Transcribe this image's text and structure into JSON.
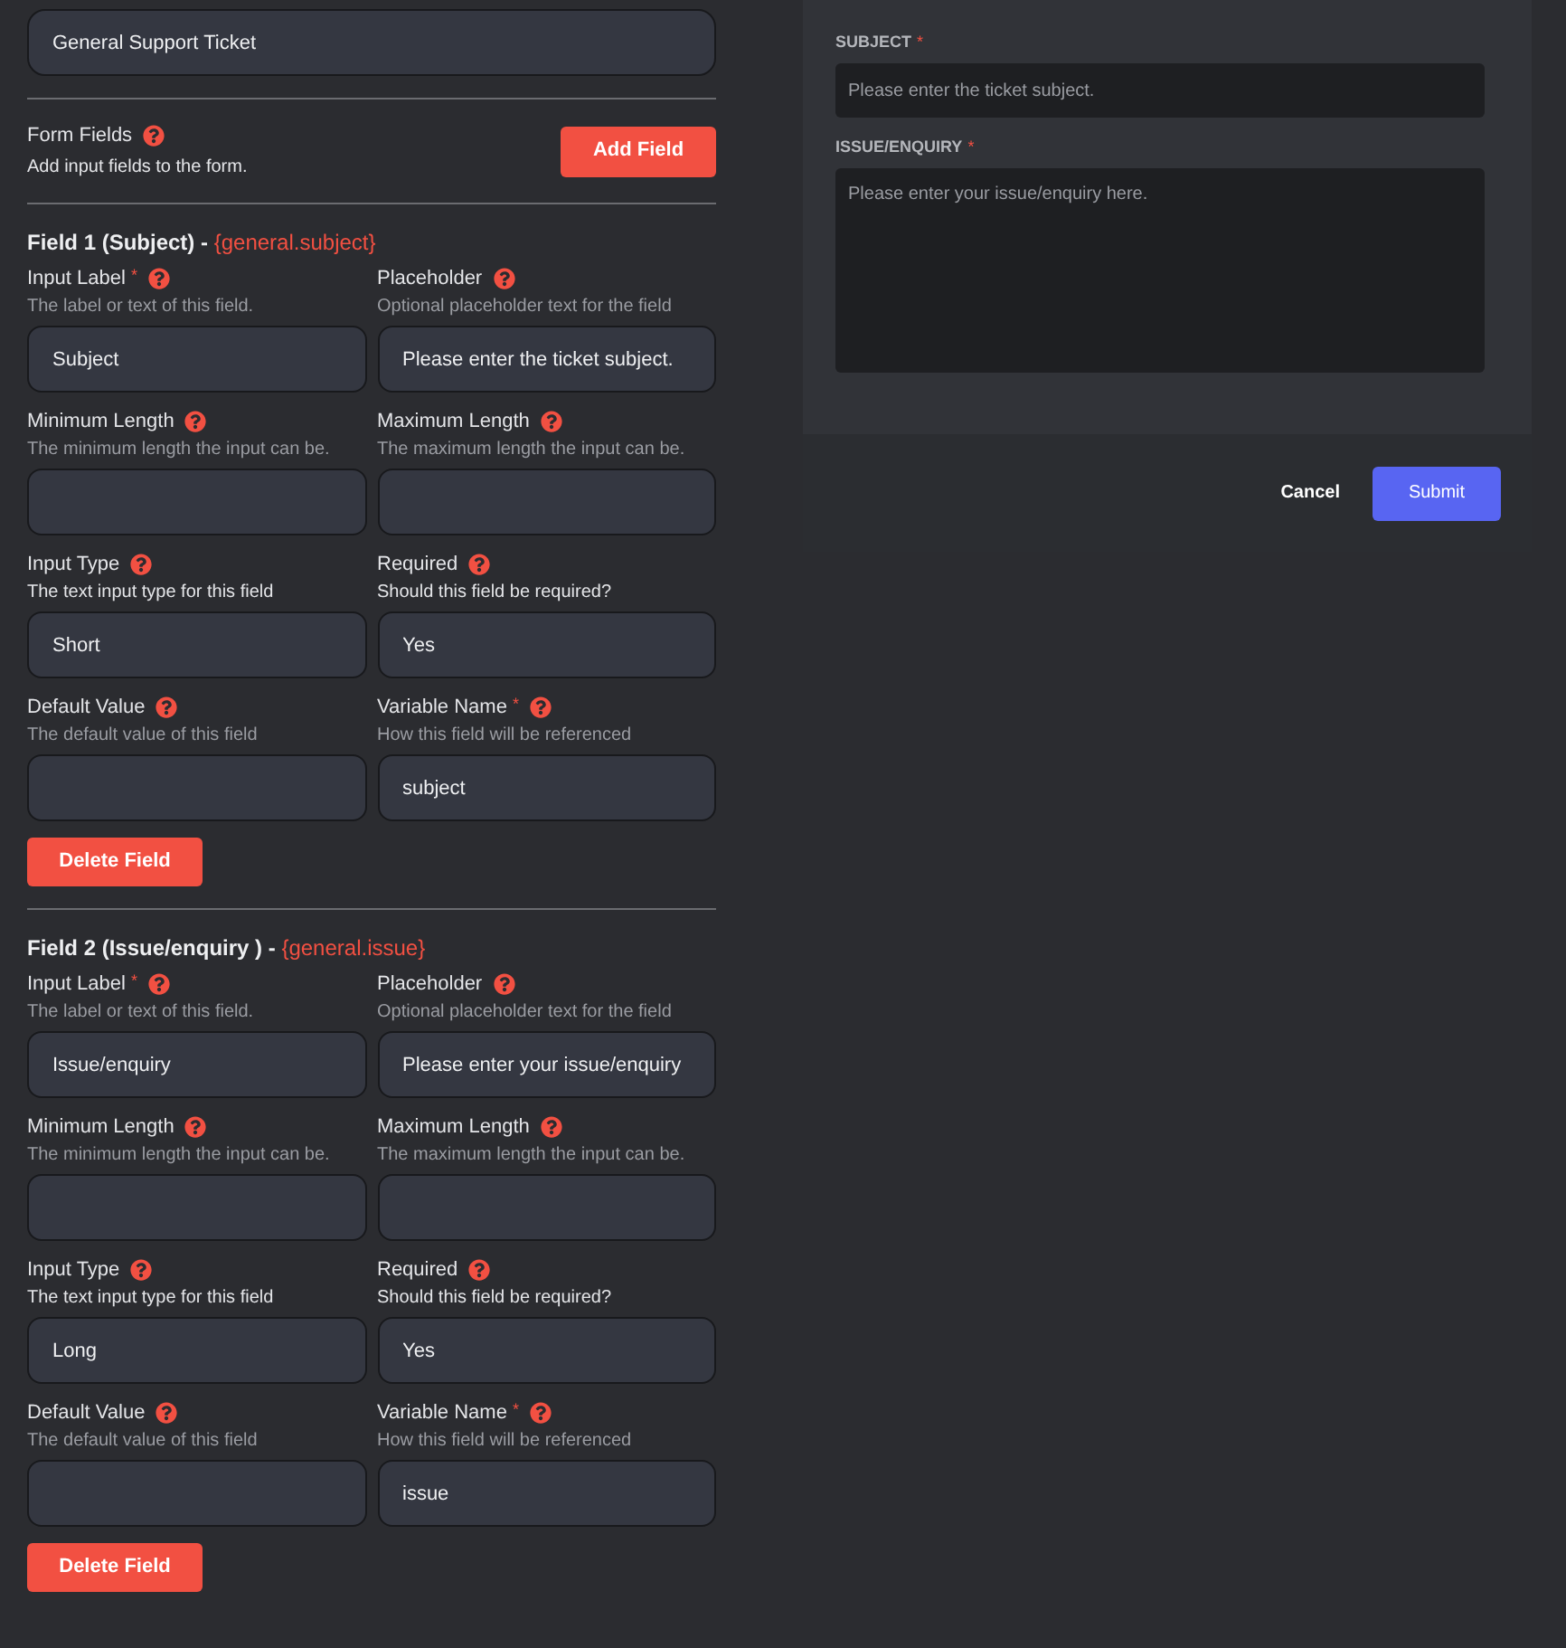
{
  "form_name": {
    "value": "General Support Ticket"
  },
  "form_fields": {
    "title": "Form Fields",
    "description": "Add input fields to the form.",
    "add_button": "Add Field"
  },
  "fields": [
    {
      "title": "Field 1 (Subject) - ",
      "variable_ref": "{general.subject}",
      "delete_button": "Delete Field",
      "settings": [
        {
          "label": "Input Label",
          "required_mark": "*",
          "description": "The label or text of this field.",
          "emphasis": false,
          "value": "Subject"
        },
        {
          "label": "Placeholder",
          "description": "Optional placeholder text for the field",
          "emphasis": false,
          "value": "Please enter the ticket subject."
        },
        {
          "label": "Minimum Length",
          "description": "The minimum length the input can be.",
          "emphasis": false
        },
        {
          "label": "Maximum Length",
          "description": "The maximum length the input can be.",
          "emphasis": false
        },
        {
          "label": "Input Type",
          "description": "The text input type for this field",
          "emphasis": true,
          "value": "Short"
        },
        {
          "label": "Required",
          "description": "Should this field be required?",
          "emphasis": true,
          "value": "Yes"
        },
        {
          "label": "Default Value",
          "description": "The default value of this field",
          "emphasis": false
        },
        {
          "label": "Variable Name",
          "required_mark": "*",
          "description": "How this field will be referenced",
          "emphasis": false,
          "value": "subject"
        }
      ]
    },
    {
      "title": "Field 2 (Issue/enquiry ) - ",
      "variable_ref": "{general.issue}",
      "delete_button": "Delete Field",
      "settings": [
        {
          "label": "Input Label",
          "required_mark": "*",
          "description": "The label or text of this field.",
          "emphasis": false,
          "value": "Issue/enquiry"
        },
        {
          "label": "Placeholder",
          "description": "Optional placeholder text for the field",
          "emphasis": false,
          "value": "Please enter your issue/enquiry"
        },
        {
          "label": "Minimum Length",
          "description": "The minimum length the input can be.",
          "emphasis": false
        },
        {
          "label": "Maximum Length",
          "description": "The maximum length the input can be.",
          "emphasis": false
        },
        {
          "label": "Input Type",
          "description": "The text input type for this field",
          "emphasis": true,
          "value": "Long"
        },
        {
          "label": "Required",
          "description": "Should this field be required?",
          "emphasis": true,
          "value": "Yes"
        },
        {
          "label": "Default Value",
          "description": "The default value of this field",
          "emphasis": false
        },
        {
          "label": "Variable Name",
          "required_mark": "*",
          "description": "How this field will be referenced",
          "emphasis": false,
          "value": "issue"
        }
      ]
    }
  ],
  "preview": {
    "inputs": [
      {
        "label": "SUBJECT",
        "required_mark": "*",
        "kind": "short",
        "placeholder": "Please enter the ticket subject."
      },
      {
        "label": "ISSUE/ENQUIRY",
        "required_mark": "*",
        "kind": "long",
        "placeholder": "Please enter your issue/enquiry here."
      }
    ],
    "cancel_button": "Cancel",
    "submit_button": "Submit"
  }
}
